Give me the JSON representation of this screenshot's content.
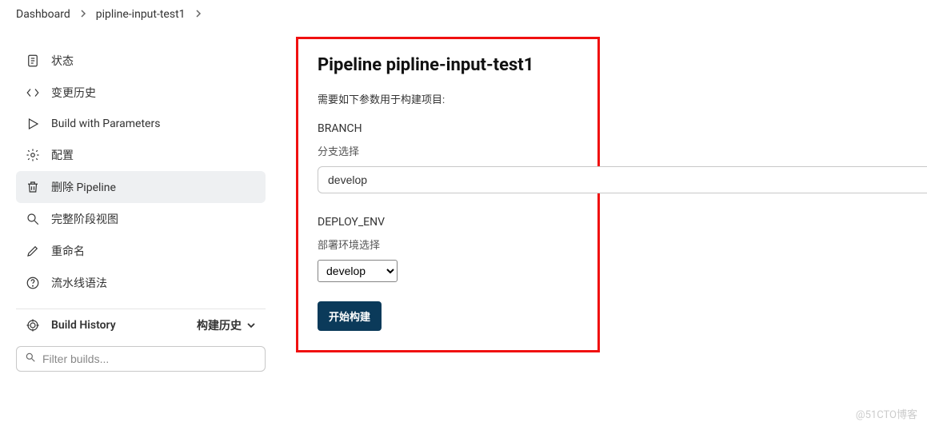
{
  "breadcrumb": {
    "items": [
      "Dashboard",
      "pipline-input-test1"
    ]
  },
  "sidebar": {
    "items": [
      {
        "icon": "status-icon",
        "label": "状态"
      },
      {
        "icon": "code-icon",
        "label": "变更历史"
      },
      {
        "icon": "play-icon",
        "label": "Build with Parameters"
      },
      {
        "icon": "gear-icon",
        "label": "配置"
      },
      {
        "icon": "trash-icon",
        "label": "删除 Pipeline",
        "highlight": true
      },
      {
        "icon": "search-icon",
        "label": "完整阶段视图"
      },
      {
        "icon": "pencil-icon",
        "label": "重命名"
      },
      {
        "icon": "help-icon",
        "label": "流水线语法"
      }
    ],
    "build_history": {
      "title": "Build History",
      "toggle_label": "构建历史"
    },
    "filter": {
      "placeholder": "Filter builds..."
    }
  },
  "main": {
    "title": "Pipeline pipline-input-test1",
    "description": "需要如下参数用于构建项目:",
    "params": {
      "branch": {
        "name": "BRANCH",
        "hint": "分支选择",
        "value": "develop"
      },
      "deploy_env": {
        "name": "DEPLOY_ENV",
        "hint": "部署环境选择",
        "selected": "develop"
      }
    },
    "submit_label": "开始构建"
  },
  "watermark": "@51CTO博客"
}
